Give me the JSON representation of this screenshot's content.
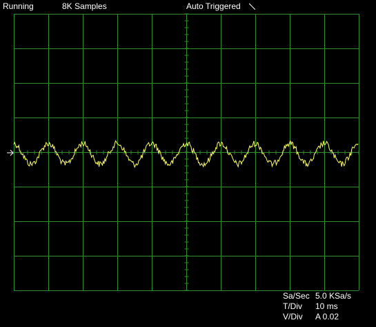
{
  "status_bar": {
    "run_state": "Running",
    "sample_depth": "8K Samples",
    "trigger_state": "Auto Triggered",
    "trigger_slope_icon": "falling-edge-slope-icon"
  },
  "readouts": {
    "sample_rate_label": "Sa/Sec",
    "sample_rate_value": "5.0 KSa/s",
    "time_div_label": "T/Div",
    "time_div_value": "10 ms",
    "volt_div_label": "V/Div",
    "volt_div_value": "A 0.02"
  },
  "display": {
    "grid_color": "#2f8f2f",
    "trace_color": "#ffff66",
    "background": "#000000",
    "horizontal_divisions": 10,
    "vertical_divisions": 8,
    "channel_marker_icon": "channel-a-ground-arrow-icon"
  },
  "waveform": {
    "channel": "A",
    "cycles_visible": 10,
    "amplitude_divisions": 0.5,
    "noise": true
  }
}
